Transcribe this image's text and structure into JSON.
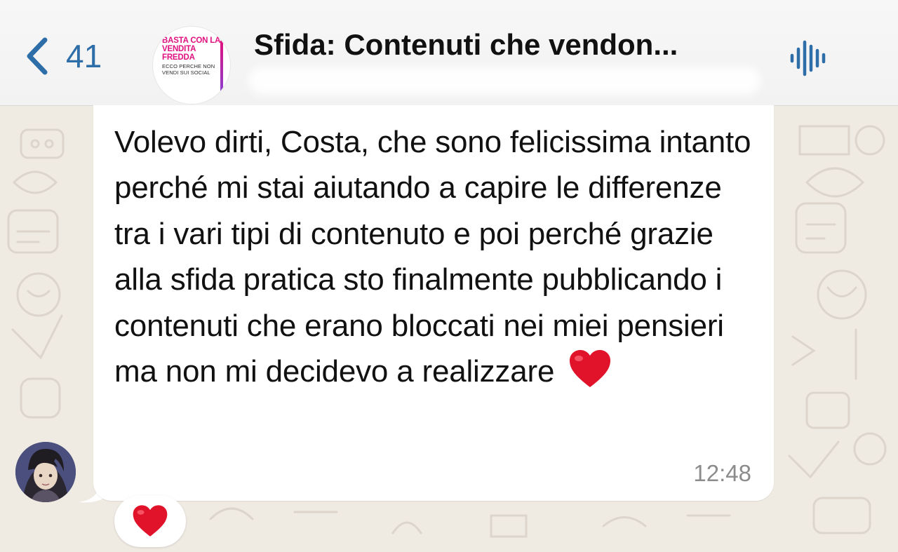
{
  "header": {
    "back_count": "41",
    "title": "Sfida: Contenuti che vendon...",
    "group_avatar": {
      "headline": "BASTA CON LA VENDITA FREDDA",
      "tagline": "ECCO PERCHE NON VENDI SUI SOCIAL"
    }
  },
  "message": {
    "text": "Volevo dirti, Costa, che sono felicissima intanto perché mi stai aiutando a capire le differenze tra i vari tipi di contenuto e poi perché grazie alla sfida pratica sto finalmente pubblicando i contenuti che erano bloccati nei miei pensieri ma non mi decidevo a realizzare",
    "emoji": "heart-emoji",
    "time": "12:48",
    "reaction": "heart-emoji"
  },
  "colors": {
    "accent": "#2e6ea8",
    "brand_pink": "#e0117f",
    "heart": "#e1132b",
    "chat_bg": "#efeae2"
  },
  "icons": {
    "back": "chevron-left-icon",
    "audio": "audio-waveform-icon"
  }
}
